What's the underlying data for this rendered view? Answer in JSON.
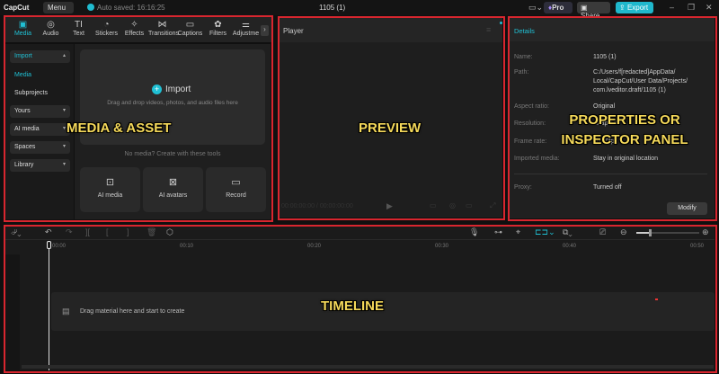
{
  "topbar": {
    "app_name": "CapCut",
    "menu_label": "Menu",
    "autosave": "Auto saved: 16:16:25",
    "project_title": "1105 (1)",
    "pro_label": "Pro",
    "share_label": "Share",
    "export_label": "Export"
  },
  "media_tabs": [
    {
      "label": "Media",
      "icon": "▣"
    },
    {
      "label": "Audio",
      "icon": "◎"
    },
    {
      "label": "Text",
      "icon": "TI"
    },
    {
      "label": "Stickers",
      "icon": "◔"
    },
    {
      "label": "Effects",
      "icon": "✧"
    },
    {
      "label": "Transitions",
      "icon": "⋈"
    },
    {
      "label": "Captions",
      "icon": "▭"
    },
    {
      "label": "Filters",
      "icon": "✿"
    },
    {
      "label": "Adjustme",
      "icon": "⚌"
    }
  ],
  "sidebar": {
    "import": "Import",
    "media": "Media",
    "subprojects": "Subprojects",
    "groups": [
      "Yours",
      "AI media",
      "Spaces",
      "Library"
    ]
  },
  "import_area": {
    "title": "Import",
    "hint": "Drag and drop videos, photos, and audio files here",
    "divider": "No media? Create with these tools",
    "tools": [
      "AI media",
      "AI avatars",
      "Record"
    ]
  },
  "player": {
    "title": "Player",
    "timecode": "00:00:00:00 / 00:00:00:00"
  },
  "details": {
    "title": "Details",
    "rows": [
      {
        "k": "Name:",
        "v": "1105 (1)"
      },
      {
        "k": "Path:",
        "v": "C:/Users/f[redacted]AppData/ Local/CapCut/User Data/Projects/ com.lveditor.draft/1105 (1)"
      },
      {
        "k": "Aspect ratio:",
        "v": "Original"
      },
      {
        "k": "Resolution:",
        "v": "Adapted"
      },
      {
        "k": "Frame rate:",
        "v": "30.00fps"
      },
      {
        "k": "Imported media:",
        "v": "Stay in original location"
      },
      {
        "k": "Proxy:",
        "v": "Turned off"
      }
    ],
    "modify": "Modify"
  },
  "timeline": {
    "ticks": [
      "00:00",
      "00:10",
      "00:20",
      "00:30",
      "00:40",
      "00:50"
    ],
    "drop_hint": "Drag material here and start to create"
  },
  "annotations": {
    "media": "MEDIA & ASSET",
    "preview": "PREVIEW",
    "inspector": "PROPERTIES OR INSPECTOR PANEL",
    "timeline": "TIMELINE"
  }
}
